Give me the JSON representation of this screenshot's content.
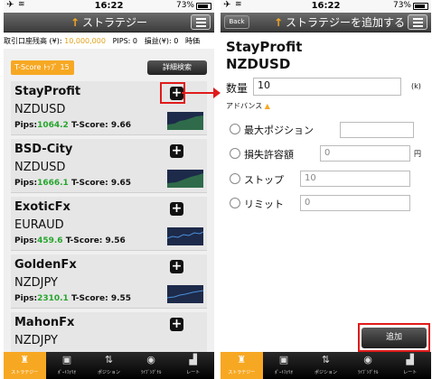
{
  "status_bar": {
    "time": "16:22",
    "battery": "73%"
  },
  "left": {
    "title": "ストラテジー",
    "ticker": {
      "label": "取引口座残高 (¥):",
      "balance": "10,000,000",
      "pips_label": "PIPS:",
      "pips_value": "0",
      "pl_label": "損益(¥):",
      "pl_value": "0",
      "time_label": "時価"
    },
    "tscore_label": "T-Score ﾄｯﾌﾟ 15",
    "detail_search": "詳細検索",
    "strategies": [
      {
        "name": "StayProfit",
        "pair": "NZDUSD",
        "pips_label": "Pips:",
        "pips": "1064.2",
        "tscore_label": "T-Score:",
        "tscore": "9.66"
      },
      {
        "name": "BSD-City",
        "pair": "NZDUSD",
        "pips_label": "Pips:",
        "pips": "1666.1",
        "tscore_label": "T-Score:",
        "tscore": "9.65"
      },
      {
        "name": "ExoticFx",
        "pair": "EURAUD",
        "pips_label": "Pips:",
        "pips": "459.6",
        "tscore_label": "T-Score:",
        "tscore": "9.56"
      },
      {
        "name": "GoldenFx",
        "pair": "NZDJPY",
        "pips_label": "Pips:",
        "pips": "2310.1",
        "tscore_label": "T-Score:",
        "tscore": "9.55"
      },
      {
        "name": "MahonFx",
        "pair": "NZDJPY"
      }
    ]
  },
  "right": {
    "back": "Back",
    "title": "ストラテジーを追加する",
    "strategy_name": "StayProfit",
    "pair": "NZDUSD",
    "quantity_label": "数量",
    "quantity_value": "10",
    "quantity_unit": "(k)",
    "advanced_label": "アドバンス",
    "max_position_label": "最大ポジション",
    "loss_label": "損失許容額",
    "loss_value": "0",
    "loss_unit": "円",
    "stop_label": "ストップ",
    "stop_value": "10",
    "limit_label": "リミット",
    "limit_value": "0",
    "add_button": "追加"
  },
  "tabs": [
    {
      "icon": "♜",
      "label": "ストラテジー"
    },
    {
      "icon": "▣",
      "label": "ﾎﾟｰﾄﾌｫﾘｵ"
    },
    {
      "icon": "⇅",
      "label": "ポジション"
    },
    {
      "icon": "◉",
      "label": "ﾗｲﾌﾞｼｸﾞﾅﾙ"
    },
    {
      "icon": "▟",
      "label": "レート"
    }
  ],
  "colors": {
    "accent": "#f7a823",
    "highlight": "#e01b1b",
    "pips_green": "#27a52e"
  }
}
